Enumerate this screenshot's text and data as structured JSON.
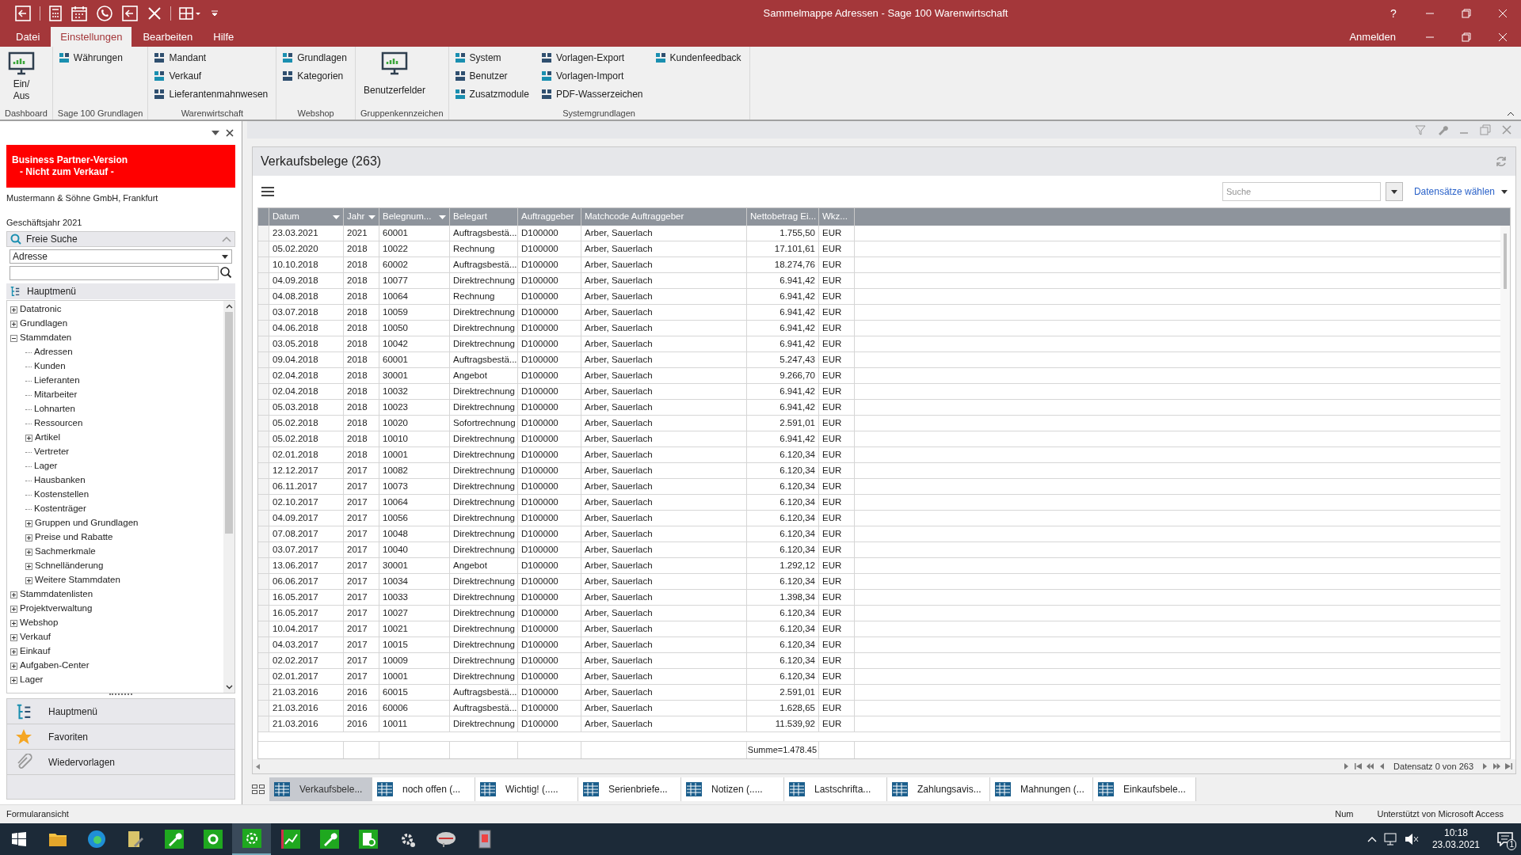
{
  "window": {
    "title": "Sammelmappe Adressen - Sage 100 Warenwirtschaft",
    "help": "?",
    "login": "Anmelden"
  },
  "menu_tabs": [
    {
      "label": "Datei",
      "selected": false
    },
    {
      "label": "Einstellungen",
      "selected": true
    },
    {
      "label": "Bearbeiten",
      "selected": false
    },
    {
      "label": "Hilfe",
      "selected": false
    }
  ],
  "ribbon_groups": [
    {
      "label": "Dashboard",
      "kind": "large",
      "items": [
        "Ein/\nAus"
      ]
    },
    {
      "label": "Sage 100 Grundlagen",
      "kind": "small",
      "items": [
        "Währungen"
      ]
    },
    {
      "label": "Warenwirtschaft",
      "kind": "small",
      "items": [
        "Mandant",
        "Verkauf",
        "Lieferantenmahnwesen"
      ]
    },
    {
      "label": "Webshop",
      "kind": "small",
      "items": [
        "Grundlagen",
        "Kategorien"
      ]
    },
    {
      "label": "Gruppenkennzeichen",
      "kind": "large",
      "items": [
        "Benutzerfelder"
      ]
    },
    {
      "label": "Systemgrundlagen",
      "kind": "small",
      "items": [
        "System",
        "Benutzer",
        "Zusatzmodule",
        "Vorlagen-Export",
        "Vorlagen-Import",
        "PDF-Wasserzeichen",
        "Kundenfeedback"
      ]
    }
  ],
  "sidebar": {
    "banner": [
      "Business Partner-Version",
      "- Nicht zum Verkauf -"
    ],
    "company": "Mustermann & Söhne GmbH, Frankfurt",
    "fiscal_year": "Geschäftsjahr 2021",
    "search_header": "Freie Suche",
    "search_type": "Adresse",
    "menu_header": "Hauptmenü",
    "tree": [
      {
        "label": "Datatronic",
        "expanded": false
      },
      {
        "label": "Grundlagen",
        "expanded": false
      },
      {
        "label": "Stammdaten",
        "expanded": true,
        "children": [
          {
            "label": "Adressen"
          },
          {
            "label": "Kunden"
          },
          {
            "label": "Lieferanten"
          },
          {
            "label": "Mitarbeiter"
          },
          {
            "label": "Lohnarten"
          },
          {
            "label": "Ressourcen"
          },
          {
            "label": "Artikel",
            "expanded": false
          },
          {
            "label": "Vertreter"
          },
          {
            "label": "Lager"
          },
          {
            "label": "Hausbanken"
          },
          {
            "label": "Kostenstellen"
          },
          {
            "label": "Kostenträger"
          },
          {
            "label": "Gruppen und Grundlagen",
            "expanded": false
          },
          {
            "label": "Preise und Rabatte",
            "expanded": false
          },
          {
            "label": "Sachmerkmale",
            "expanded": false
          },
          {
            "label": "Schnelländerung",
            "expanded": false
          },
          {
            "label": "Weitere Stammdaten",
            "expanded": false
          }
        ]
      },
      {
        "label": "Stammdatenlisten",
        "expanded": false
      },
      {
        "label": "Projektverwaltung",
        "expanded": false
      },
      {
        "label": "Webshop",
        "expanded": false
      },
      {
        "label": "Verkauf",
        "expanded": false
      },
      {
        "label": "Einkauf",
        "expanded": false
      },
      {
        "label": "Aufgaben-Center",
        "expanded": false
      },
      {
        "label": "Lager",
        "expanded": false
      }
    ],
    "nav_buttons": [
      {
        "kind": "menu",
        "label": "Hauptmenü"
      },
      {
        "kind": "favorites",
        "label": "Favoriten"
      },
      {
        "kind": "attachments",
        "label": "Wiedervorlagen"
      }
    ]
  },
  "list": {
    "title": "Verkaufsbelege (263)",
    "search_placeholder": "Suche",
    "select_records": "Datensätze wählen",
    "table": {
      "columns": [
        {
          "label": "Datum",
          "filter": true
        },
        {
          "label": "Jahr",
          "filter": true
        },
        {
          "label": "Belegnum...",
          "filter": true
        },
        {
          "label": "Belegart",
          "filter": false
        },
        {
          "label": "Auftraggeber",
          "filter": false
        },
        {
          "label": "Matchcode Auftraggeber",
          "filter": false
        },
        {
          "label": "Nettobetrag Ei...",
          "filter": false
        },
        {
          "label": "Wkz...",
          "filter": false
        }
      ],
      "rows": [
        [
          "23.03.2021",
          "2021",
          "60001",
          "Auftragsbestä...",
          "D100000",
          "Arber, Sauerlach",
          "1.755,50",
          "EUR"
        ],
        [
          "05.02.2020",
          "2018",
          "10022",
          "Rechnung",
          "D100000",
          "Arber, Sauerlach",
          "17.101,61",
          "EUR"
        ],
        [
          "10.10.2018",
          "2018",
          "60002",
          "Auftragsbestä...",
          "D100000",
          "Arber, Sauerlach",
          "18.274,76",
          "EUR"
        ],
        [
          "04.09.2018",
          "2018",
          "10077",
          "Direktrechnung",
          "D100000",
          "Arber, Sauerlach",
          "6.941,42",
          "EUR"
        ],
        [
          "04.08.2018",
          "2018",
          "10064",
          "Rechnung",
          "D100000",
          "Arber, Sauerlach",
          "6.941,42",
          "EUR"
        ],
        [
          "03.07.2018",
          "2018",
          "10059",
          "Direktrechnung",
          "D100000",
          "Arber, Sauerlach",
          "6.941,42",
          "EUR"
        ],
        [
          "04.06.2018",
          "2018",
          "10050",
          "Direktrechnung",
          "D100000",
          "Arber, Sauerlach",
          "6.941,42",
          "EUR"
        ],
        [
          "03.05.2018",
          "2018",
          "10042",
          "Direktrechnung",
          "D100000",
          "Arber, Sauerlach",
          "6.941,42",
          "EUR"
        ],
        [
          "09.04.2018",
          "2018",
          "60001",
          "Auftragsbestä...",
          "D100000",
          "Arber, Sauerlach",
          "5.247,43",
          "EUR"
        ],
        [
          "02.04.2018",
          "2018",
          "30001",
          "Angebot",
          "D100000",
          "Arber, Sauerlach",
          "9.266,70",
          "EUR"
        ],
        [
          "02.04.2018",
          "2018",
          "10032",
          "Direktrechnung",
          "D100000",
          "Arber, Sauerlach",
          "6.941,42",
          "EUR"
        ],
        [
          "05.03.2018",
          "2018",
          "10023",
          "Direktrechnung",
          "D100000",
          "Arber, Sauerlach",
          "6.941,42",
          "EUR"
        ],
        [
          "05.02.2018",
          "2018",
          "10020",
          "Sofortrechnung",
          "D100000",
          "Arber, Sauerlach",
          "2.591,01",
          "EUR"
        ],
        [
          "05.02.2018",
          "2018",
          "10010",
          "Direktrechnung",
          "D100000",
          "Arber, Sauerlach",
          "6.941,42",
          "EUR"
        ],
        [
          "02.01.2018",
          "2018",
          "10001",
          "Direktrechnung",
          "D100000",
          "Arber, Sauerlach",
          "6.120,34",
          "EUR"
        ],
        [
          "12.12.2017",
          "2017",
          "10082",
          "Direktrechnung",
          "D100000",
          "Arber, Sauerlach",
          "6.120,34",
          "EUR"
        ],
        [
          "06.11.2017",
          "2017",
          "10073",
          "Direktrechnung",
          "D100000",
          "Arber, Sauerlach",
          "6.120,34",
          "EUR"
        ],
        [
          "02.10.2017",
          "2017",
          "10064",
          "Direktrechnung",
          "D100000",
          "Arber, Sauerlach",
          "6.120,34",
          "EUR"
        ],
        [
          "04.09.2017",
          "2017",
          "10056",
          "Direktrechnung",
          "D100000",
          "Arber, Sauerlach",
          "6.120,34",
          "EUR"
        ],
        [
          "07.08.2017",
          "2017",
          "10048",
          "Direktrechnung",
          "D100000",
          "Arber, Sauerlach",
          "6.120,34",
          "EUR"
        ],
        [
          "03.07.2017",
          "2017",
          "10040",
          "Direktrechnung",
          "D100000",
          "Arber, Sauerlach",
          "6.120,34",
          "EUR"
        ],
        [
          "13.06.2017",
          "2017",
          "30001",
          "Angebot",
          "D100000",
          "Arber, Sauerlach",
          "1.292,12",
          "EUR"
        ],
        [
          "06.06.2017",
          "2017",
          "10034",
          "Direktrechnung",
          "D100000",
          "Arber, Sauerlach",
          "6.120,34",
          "EUR"
        ],
        [
          "16.05.2017",
          "2017",
          "10033",
          "Direktrechnung",
          "D100000",
          "Arber, Sauerlach",
          "1.398,34",
          "EUR"
        ],
        [
          "16.05.2017",
          "2017",
          "10027",
          "Direktrechnung",
          "D100000",
          "Arber, Sauerlach",
          "6.120,34",
          "EUR"
        ],
        [
          "10.04.2017",
          "2017",
          "10021",
          "Direktrechnung",
          "D100000",
          "Arber, Sauerlach",
          "6.120,34",
          "EUR"
        ],
        [
          "04.03.2017",
          "2017",
          "10015",
          "Direktrechnung",
          "D100000",
          "Arber, Sauerlach",
          "6.120,34",
          "EUR"
        ],
        [
          "02.02.2017",
          "2017",
          "10009",
          "Direktrechnung",
          "D100000",
          "Arber, Sauerlach",
          "6.120,34",
          "EUR"
        ],
        [
          "02.01.2017",
          "2017",
          "10001",
          "Direktrechnung",
          "D100000",
          "Arber, Sauerlach",
          "6.120,34",
          "EUR"
        ],
        [
          "21.03.2016",
          "2016",
          "60015",
          "Auftragsbestä...",
          "D100000",
          "Arber, Sauerlach",
          "2.591,01",
          "EUR"
        ],
        [
          "21.03.2016",
          "2016",
          "60006",
          "Auftragsbestä...",
          "D100000",
          "Arber, Sauerlach",
          "1.628,65",
          "EUR"
        ],
        [
          "21.03.2016",
          "2016",
          "10011",
          "Direktrechnung",
          "D100000",
          "Arber, Sauerlach",
          "11.539,92",
          "EUR"
        ]
      ],
      "sum": "Summe=1.478.45"
    },
    "record_status": "Datensatz 0 von 263"
  },
  "doc_tabs": [
    {
      "label": "Verkaufsbele...",
      "selected": true
    },
    {
      "label": "noch offen (...",
      "selected": false
    },
    {
      "label": "Wichtig! (.....",
      "selected": false
    },
    {
      "label": "Serienbriefe...",
      "selected": false
    },
    {
      "label": "Notizen (.....",
      "selected": false
    },
    {
      "label": "Lastschrifta...",
      "selected": false
    },
    {
      "label": "Zahlungsavis...",
      "selected": false
    },
    {
      "label": "Mahnungen (...",
      "selected": false
    },
    {
      "label": "Einkaufsbele...",
      "selected": false
    }
  ],
  "status_bar": {
    "left": "Formularansicht",
    "num": "Num",
    "right": "Unterstützt von Microsoft Access"
  },
  "taskbar": {
    "time": "10:18",
    "date": "23.03.2021",
    "notifications": "1"
  }
}
